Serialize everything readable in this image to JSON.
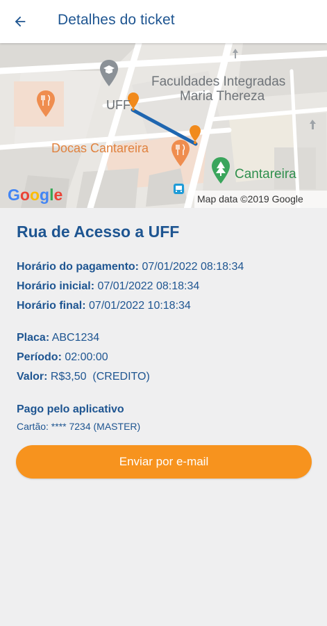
{
  "header": {
    "back_icon": "arrow-left-icon",
    "title": "Detalhes do ticket"
  },
  "map": {
    "labels": {
      "uff": "UFF",
      "faculdades_line1": "Faculdades Integradas",
      "faculdades_line2": "Maria Thereza",
      "docas": "Docas Cantareira",
      "cantareira": "Cantareira",
      "google": "Google",
      "attribution": "Map data ©2019 Google"
    },
    "colors": {
      "route": "#1f66b0",
      "pin": "#f18a1c",
      "poi_orange": "#ef8d4f",
      "park_green": "#3aa55c",
      "poi_gray": "#8b9197"
    }
  },
  "ticket": {
    "street": "Rua de Acesso a UFF",
    "payment_time_label": "Horário do pagamento:",
    "payment_time_value": "07/01/2022 08:18:34",
    "start_time_label": "Horário inicial:",
    "start_time_value": "07/01/2022 08:18:34",
    "end_time_label": "Horário final:",
    "end_time_value": "07/01/2022 10:18:34",
    "plate_label": "Placa:",
    "plate_value": "ABC1234",
    "period_label": "Período:",
    "period_value": "02:00:00",
    "amount_label": "Valor:",
    "amount_value": "R$3,50  (CREDITO)",
    "paid_via": "Pago pelo aplicativo",
    "card": "Cartão: **** 7234 (MASTER)"
  },
  "actions": {
    "send_email": "Enviar por e-mail"
  },
  "colors": {
    "primary_text": "#1e5591",
    "accent_button": "#f7931e",
    "background": "#efeff0"
  }
}
